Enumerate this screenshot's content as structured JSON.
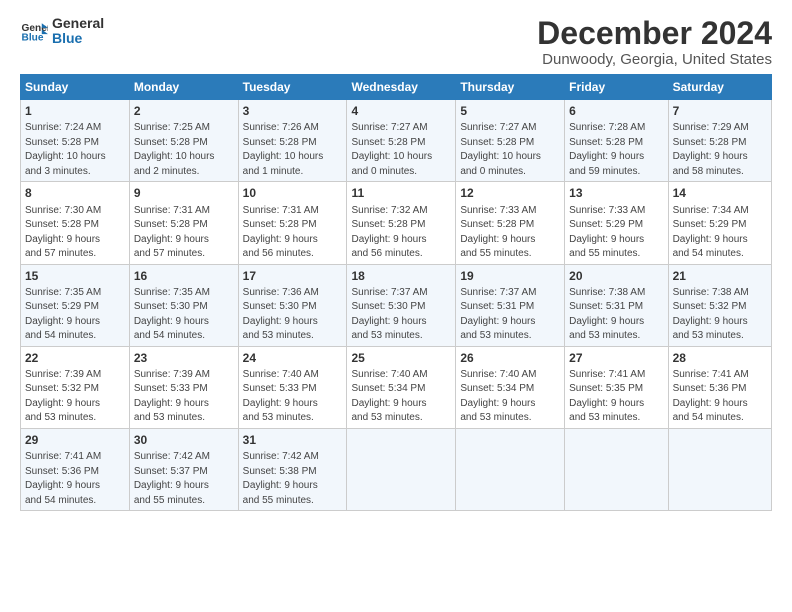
{
  "logo": {
    "line1": "General",
    "line2": "Blue"
  },
  "title": "December 2024",
  "subtitle": "Dunwoody, Georgia, United States",
  "days_header": [
    "Sunday",
    "Monday",
    "Tuesday",
    "Wednesday",
    "Thursday",
    "Friday",
    "Saturday"
  ],
  "weeks": [
    [
      {
        "day": "1",
        "info": "Sunrise: 7:24 AM\nSunset: 5:28 PM\nDaylight: 10 hours\nand 3 minutes."
      },
      {
        "day": "2",
        "info": "Sunrise: 7:25 AM\nSunset: 5:28 PM\nDaylight: 10 hours\nand 2 minutes."
      },
      {
        "day": "3",
        "info": "Sunrise: 7:26 AM\nSunset: 5:28 PM\nDaylight: 10 hours\nand 1 minute."
      },
      {
        "day": "4",
        "info": "Sunrise: 7:27 AM\nSunset: 5:28 PM\nDaylight: 10 hours\nand 0 minutes."
      },
      {
        "day": "5",
        "info": "Sunrise: 7:27 AM\nSunset: 5:28 PM\nDaylight: 10 hours\nand 0 minutes."
      },
      {
        "day": "6",
        "info": "Sunrise: 7:28 AM\nSunset: 5:28 PM\nDaylight: 9 hours\nand 59 minutes."
      },
      {
        "day": "7",
        "info": "Sunrise: 7:29 AM\nSunset: 5:28 PM\nDaylight: 9 hours\nand 58 minutes."
      }
    ],
    [
      {
        "day": "8",
        "info": "Sunrise: 7:30 AM\nSunset: 5:28 PM\nDaylight: 9 hours\nand 57 minutes."
      },
      {
        "day": "9",
        "info": "Sunrise: 7:31 AM\nSunset: 5:28 PM\nDaylight: 9 hours\nand 57 minutes."
      },
      {
        "day": "10",
        "info": "Sunrise: 7:31 AM\nSunset: 5:28 PM\nDaylight: 9 hours\nand 56 minutes."
      },
      {
        "day": "11",
        "info": "Sunrise: 7:32 AM\nSunset: 5:28 PM\nDaylight: 9 hours\nand 56 minutes."
      },
      {
        "day": "12",
        "info": "Sunrise: 7:33 AM\nSunset: 5:28 PM\nDaylight: 9 hours\nand 55 minutes."
      },
      {
        "day": "13",
        "info": "Sunrise: 7:33 AM\nSunset: 5:29 PM\nDaylight: 9 hours\nand 55 minutes."
      },
      {
        "day": "14",
        "info": "Sunrise: 7:34 AM\nSunset: 5:29 PM\nDaylight: 9 hours\nand 54 minutes."
      }
    ],
    [
      {
        "day": "15",
        "info": "Sunrise: 7:35 AM\nSunset: 5:29 PM\nDaylight: 9 hours\nand 54 minutes."
      },
      {
        "day": "16",
        "info": "Sunrise: 7:35 AM\nSunset: 5:30 PM\nDaylight: 9 hours\nand 54 minutes."
      },
      {
        "day": "17",
        "info": "Sunrise: 7:36 AM\nSunset: 5:30 PM\nDaylight: 9 hours\nand 53 minutes."
      },
      {
        "day": "18",
        "info": "Sunrise: 7:37 AM\nSunset: 5:30 PM\nDaylight: 9 hours\nand 53 minutes."
      },
      {
        "day": "19",
        "info": "Sunrise: 7:37 AM\nSunset: 5:31 PM\nDaylight: 9 hours\nand 53 minutes."
      },
      {
        "day": "20",
        "info": "Sunrise: 7:38 AM\nSunset: 5:31 PM\nDaylight: 9 hours\nand 53 minutes."
      },
      {
        "day": "21",
        "info": "Sunrise: 7:38 AM\nSunset: 5:32 PM\nDaylight: 9 hours\nand 53 minutes."
      }
    ],
    [
      {
        "day": "22",
        "info": "Sunrise: 7:39 AM\nSunset: 5:32 PM\nDaylight: 9 hours\nand 53 minutes."
      },
      {
        "day": "23",
        "info": "Sunrise: 7:39 AM\nSunset: 5:33 PM\nDaylight: 9 hours\nand 53 minutes."
      },
      {
        "day": "24",
        "info": "Sunrise: 7:40 AM\nSunset: 5:33 PM\nDaylight: 9 hours\nand 53 minutes."
      },
      {
        "day": "25",
        "info": "Sunrise: 7:40 AM\nSunset: 5:34 PM\nDaylight: 9 hours\nand 53 minutes."
      },
      {
        "day": "26",
        "info": "Sunrise: 7:40 AM\nSunset: 5:34 PM\nDaylight: 9 hours\nand 53 minutes."
      },
      {
        "day": "27",
        "info": "Sunrise: 7:41 AM\nSunset: 5:35 PM\nDaylight: 9 hours\nand 53 minutes."
      },
      {
        "day": "28",
        "info": "Sunrise: 7:41 AM\nSunset: 5:36 PM\nDaylight: 9 hours\nand 54 minutes."
      }
    ],
    [
      {
        "day": "29",
        "info": "Sunrise: 7:41 AM\nSunset: 5:36 PM\nDaylight: 9 hours\nand 54 minutes."
      },
      {
        "day": "30",
        "info": "Sunrise: 7:42 AM\nSunset: 5:37 PM\nDaylight: 9 hours\nand 55 minutes."
      },
      {
        "day": "31",
        "info": "Sunrise: 7:42 AM\nSunset: 5:38 PM\nDaylight: 9 hours\nand 55 minutes."
      },
      {
        "day": "",
        "info": ""
      },
      {
        "day": "",
        "info": ""
      },
      {
        "day": "",
        "info": ""
      },
      {
        "day": "",
        "info": ""
      }
    ]
  ]
}
